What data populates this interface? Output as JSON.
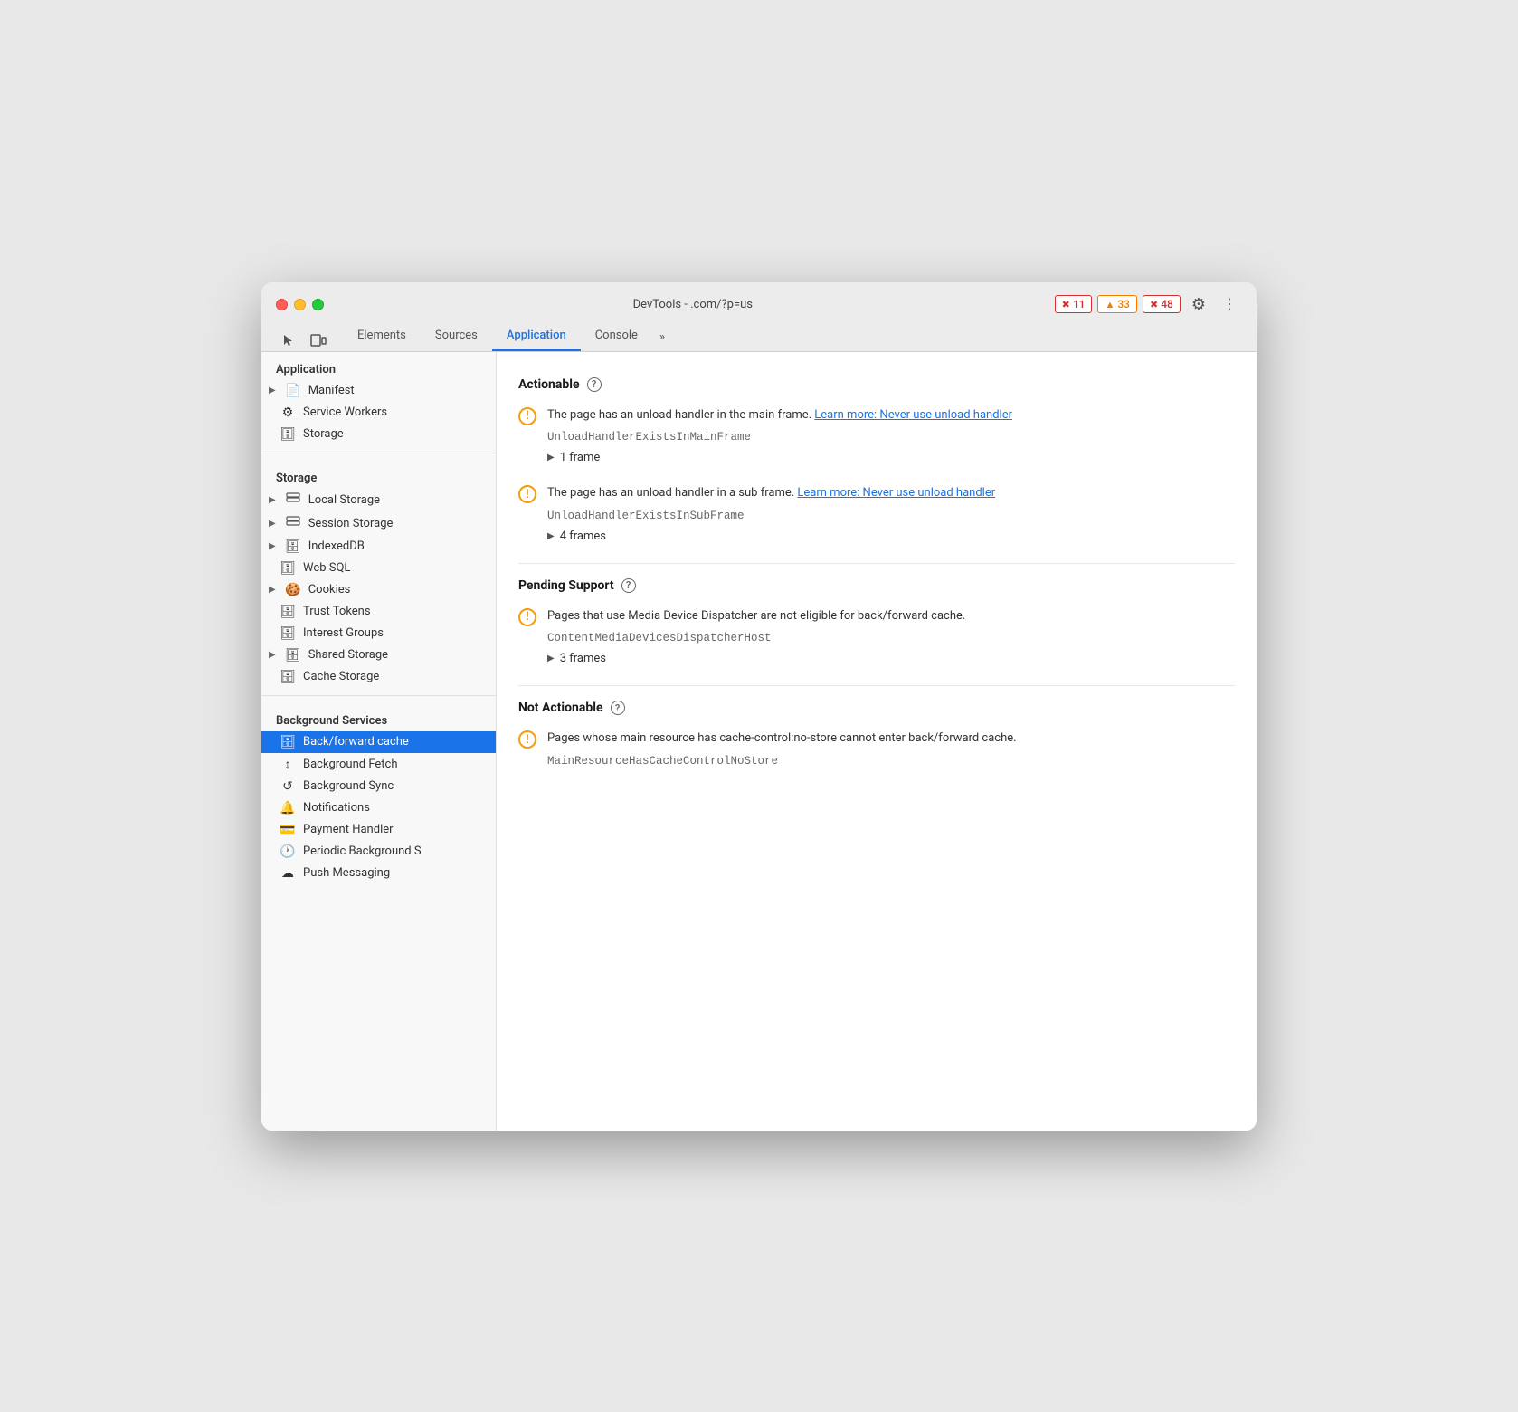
{
  "window": {
    "title": "DevTools -       .com/?p=us"
  },
  "toolbar": {
    "tabs": [
      {
        "label": "Elements",
        "active": false
      },
      {
        "label": "Sources",
        "active": false
      },
      {
        "label": "Application",
        "active": true
      },
      {
        "label": "Console",
        "active": false
      }
    ],
    "badges": [
      {
        "type": "error",
        "icon": "✖",
        "count": "11"
      },
      {
        "type": "warning",
        "icon": "▲",
        "count": "33"
      },
      {
        "type": "info",
        "icon": "✖",
        "count": "48"
      }
    ]
  },
  "sidebar": {
    "application_section": "Application",
    "app_items": [
      {
        "label": "Manifest",
        "icon": "📄",
        "hasArrow": true,
        "active": false
      },
      {
        "label": "Service Workers",
        "icon": "⚙",
        "hasArrow": false,
        "active": false
      },
      {
        "label": "Storage",
        "icon": "🗄",
        "hasArrow": false,
        "active": false
      }
    ],
    "storage_section": "Storage",
    "storage_items": [
      {
        "label": "Local Storage",
        "icon": "▦",
        "hasArrow": true,
        "active": false
      },
      {
        "label": "Session Storage",
        "icon": "▦",
        "hasArrow": true,
        "active": false
      },
      {
        "label": "IndexedDB",
        "icon": "🗄",
        "hasArrow": true,
        "active": false
      },
      {
        "label": "Web SQL",
        "icon": "🗄",
        "hasArrow": false,
        "active": false
      },
      {
        "label": "Cookies",
        "icon": "🍪",
        "hasArrow": true,
        "active": false
      },
      {
        "label": "Trust Tokens",
        "icon": "🗄",
        "hasArrow": false,
        "active": false
      },
      {
        "label": "Interest Groups",
        "icon": "🗄",
        "hasArrow": false,
        "active": false
      },
      {
        "label": "Shared Storage",
        "icon": "🗄",
        "hasArrow": true,
        "active": false
      },
      {
        "label": "Cache Storage",
        "icon": "🗄",
        "hasArrow": false,
        "active": false
      }
    ],
    "background_section": "Background Services",
    "bg_items": [
      {
        "label": "Back/forward cache",
        "icon": "🗄",
        "active": true
      },
      {
        "label": "Background Fetch",
        "icon": "↕",
        "active": false
      },
      {
        "label": "Background Sync",
        "icon": "↺",
        "active": false
      },
      {
        "label": "Notifications",
        "icon": "🔔",
        "active": false
      },
      {
        "label": "Payment Handler",
        "icon": "💳",
        "active": false
      },
      {
        "label": "Periodic Background S",
        "icon": "🕐",
        "active": false
      },
      {
        "label": "Push Messaging",
        "icon": "☁",
        "active": false
      }
    ]
  },
  "main": {
    "sections": [
      {
        "title": "Actionable",
        "items": [
          {
            "text": "The page has an unload handler in the main frame.",
            "link_text": "Learn more: Never use unload handler",
            "code": "UnloadHandlerExistsInMainFrame",
            "frames": "1 frame"
          },
          {
            "text": "The page has an unload handler in a sub frame.",
            "link_text": "Learn more: Never use unload handler",
            "code": "UnloadHandlerExistsInSubFrame",
            "frames": "4 frames"
          }
        ]
      },
      {
        "title": "Pending Support",
        "items": [
          {
            "text": "Pages that use Media Device Dispatcher are not eligible for back/forward cache.",
            "link_text": "",
            "code": "ContentMediaDevicesDispatcherHost",
            "frames": "3 frames"
          }
        ]
      },
      {
        "title": "Not Actionable",
        "items": [
          {
            "text": "Pages whose main resource has cache-control:no-store cannot enter back/forward cache.",
            "link_text": "",
            "code": "MainResourceHasCacheControlNoStore",
            "frames": ""
          }
        ]
      }
    ]
  }
}
